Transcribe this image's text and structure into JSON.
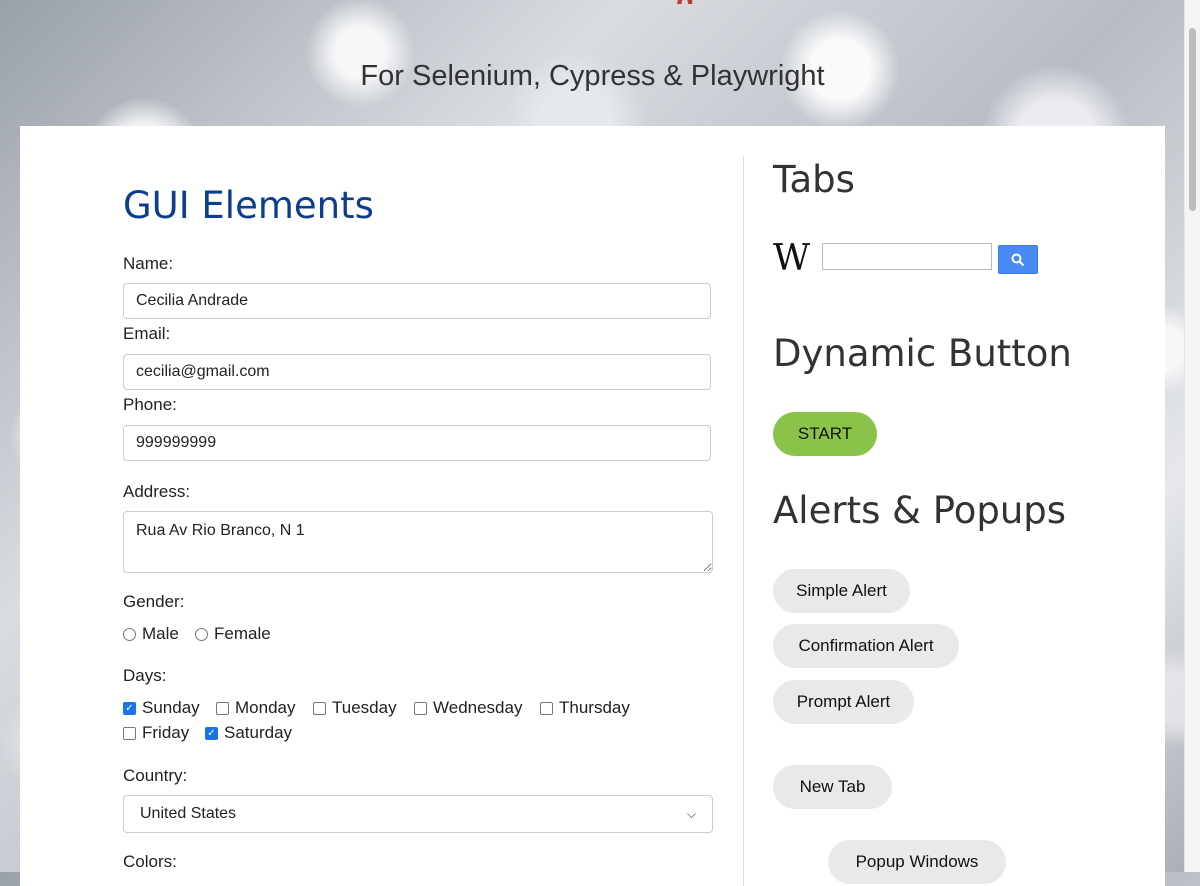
{
  "header": {
    "title_tail": "g",
    "subtitle": "For Selenium, Cypress & Playwright"
  },
  "gui": {
    "title": "GUI Elements",
    "name": {
      "label": "Name:",
      "value": "Cecilia Andrade"
    },
    "email": {
      "label": "Email:",
      "value": "cecilia@gmail.com"
    },
    "phone": {
      "label": "Phone:",
      "value": "999999999"
    },
    "address": {
      "label": "Address:",
      "value": "Rua Av Rio Branco, N 1"
    },
    "gender": {
      "label": "Gender:",
      "options": [
        "Male",
        "Female"
      ]
    },
    "days": {
      "label": "Days:",
      "items": [
        {
          "label": "Sunday",
          "checked": true
        },
        {
          "label": "Monday",
          "checked": false
        },
        {
          "label": "Tuesday",
          "checked": false
        },
        {
          "label": "Wednesday",
          "checked": false
        },
        {
          "label": "Thursday",
          "checked": false
        },
        {
          "label": "Friday",
          "checked": false
        },
        {
          "label": "Saturday",
          "checked": true
        }
      ]
    },
    "country": {
      "label": "Country:",
      "selected": "United States"
    },
    "colors": {
      "label": "Colors:"
    }
  },
  "tabs": {
    "title": "Tabs",
    "logo_letter": "W"
  },
  "dynamic": {
    "title": "Dynamic Button",
    "start_label": "START"
  },
  "alerts": {
    "title": "Alerts & Popups",
    "simple": "Simple Alert",
    "confirm": "Confirmation Alert",
    "prompt": "Prompt Alert",
    "new_tab": "New Tab",
    "popup": "Popup Windows"
  },
  "colors": {
    "title_blue": "#0b3d91",
    "start_green": "#8bc34a",
    "check_blue": "#1a73e8",
    "search_blue": "#4a8af4"
  }
}
